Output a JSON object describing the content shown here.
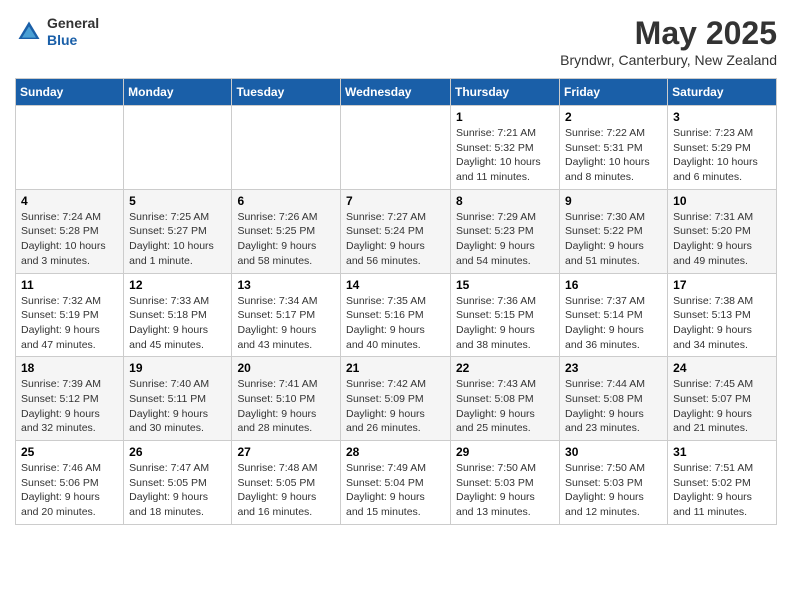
{
  "header": {
    "logo_general": "General",
    "logo_blue": "Blue",
    "month_title": "May 2025",
    "subtitle": "Bryndwr, Canterbury, New Zealand"
  },
  "days_of_week": [
    "Sunday",
    "Monday",
    "Tuesday",
    "Wednesday",
    "Thursday",
    "Friday",
    "Saturday"
  ],
  "weeks": [
    [
      {
        "day": "",
        "info": ""
      },
      {
        "day": "",
        "info": ""
      },
      {
        "day": "",
        "info": ""
      },
      {
        "day": "",
        "info": ""
      },
      {
        "day": "1",
        "info": "Sunrise: 7:21 AM\nSunset: 5:32 PM\nDaylight: 10 hours and 11 minutes."
      },
      {
        "day": "2",
        "info": "Sunrise: 7:22 AM\nSunset: 5:31 PM\nDaylight: 10 hours and 8 minutes."
      },
      {
        "day": "3",
        "info": "Sunrise: 7:23 AM\nSunset: 5:29 PM\nDaylight: 10 hours and 6 minutes."
      }
    ],
    [
      {
        "day": "4",
        "info": "Sunrise: 7:24 AM\nSunset: 5:28 PM\nDaylight: 10 hours and 3 minutes."
      },
      {
        "day": "5",
        "info": "Sunrise: 7:25 AM\nSunset: 5:27 PM\nDaylight: 10 hours and 1 minute."
      },
      {
        "day": "6",
        "info": "Sunrise: 7:26 AM\nSunset: 5:25 PM\nDaylight: 9 hours and 58 minutes."
      },
      {
        "day": "7",
        "info": "Sunrise: 7:27 AM\nSunset: 5:24 PM\nDaylight: 9 hours and 56 minutes."
      },
      {
        "day": "8",
        "info": "Sunrise: 7:29 AM\nSunset: 5:23 PM\nDaylight: 9 hours and 54 minutes."
      },
      {
        "day": "9",
        "info": "Sunrise: 7:30 AM\nSunset: 5:22 PM\nDaylight: 9 hours and 51 minutes."
      },
      {
        "day": "10",
        "info": "Sunrise: 7:31 AM\nSunset: 5:20 PM\nDaylight: 9 hours and 49 minutes."
      }
    ],
    [
      {
        "day": "11",
        "info": "Sunrise: 7:32 AM\nSunset: 5:19 PM\nDaylight: 9 hours and 47 minutes."
      },
      {
        "day": "12",
        "info": "Sunrise: 7:33 AM\nSunset: 5:18 PM\nDaylight: 9 hours and 45 minutes."
      },
      {
        "day": "13",
        "info": "Sunrise: 7:34 AM\nSunset: 5:17 PM\nDaylight: 9 hours and 43 minutes."
      },
      {
        "day": "14",
        "info": "Sunrise: 7:35 AM\nSunset: 5:16 PM\nDaylight: 9 hours and 40 minutes."
      },
      {
        "day": "15",
        "info": "Sunrise: 7:36 AM\nSunset: 5:15 PM\nDaylight: 9 hours and 38 minutes."
      },
      {
        "day": "16",
        "info": "Sunrise: 7:37 AM\nSunset: 5:14 PM\nDaylight: 9 hours and 36 minutes."
      },
      {
        "day": "17",
        "info": "Sunrise: 7:38 AM\nSunset: 5:13 PM\nDaylight: 9 hours and 34 minutes."
      }
    ],
    [
      {
        "day": "18",
        "info": "Sunrise: 7:39 AM\nSunset: 5:12 PM\nDaylight: 9 hours and 32 minutes."
      },
      {
        "day": "19",
        "info": "Sunrise: 7:40 AM\nSunset: 5:11 PM\nDaylight: 9 hours and 30 minutes."
      },
      {
        "day": "20",
        "info": "Sunrise: 7:41 AM\nSunset: 5:10 PM\nDaylight: 9 hours and 28 minutes."
      },
      {
        "day": "21",
        "info": "Sunrise: 7:42 AM\nSunset: 5:09 PM\nDaylight: 9 hours and 26 minutes."
      },
      {
        "day": "22",
        "info": "Sunrise: 7:43 AM\nSunset: 5:08 PM\nDaylight: 9 hours and 25 minutes."
      },
      {
        "day": "23",
        "info": "Sunrise: 7:44 AM\nSunset: 5:08 PM\nDaylight: 9 hours and 23 minutes."
      },
      {
        "day": "24",
        "info": "Sunrise: 7:45 AM\nSunset: 5:07 PM\nDaylight: 9 hours and 21 minutes."
      }
    ],
    [
      {
        "day": "25",
        "info": "Sunrise: 7:46 AM\nSunset: 5:06 PM\nDaylight: 9 hours and 20 minutes."
      },
      {
        "day": "26",
        "info": "Sunrise: 7:47 AM\nSunset: 5:05 PM\nDaylight: 9 hours and 18 minutes."
      },
      {
        "day": "27",
        "info": "Sunrise: 7:48 AM\nSunset: 5:05 PM\nDaylight: 9 hours and 16 minutes."
      },
      {
        "day": "28",
        "info": "Sunrise: 7:49 AM\nSunset: 5:04 PM\nDaylight: 9 hours and 15 minutes."
      },
      {
        "day": "29",
        "info": "Sunrise: 7:50 AM\nSunset: 5:03 PM\nDaylight: 9 hours and 13 minutes."
      },
      {
        "day": "30",
        "info": "Sunrise: 7:50 AM\nSunset: 5:03 PM\nDaylight: 9 hours and 12 minutes."
      },
      {
        "day": "31",
        "info": "Sunrise: 7:51 AM\nSunset: 5:02 PM\nDaylight: 9 hours and 11 minutes."
      }
    ]
  ]
}
